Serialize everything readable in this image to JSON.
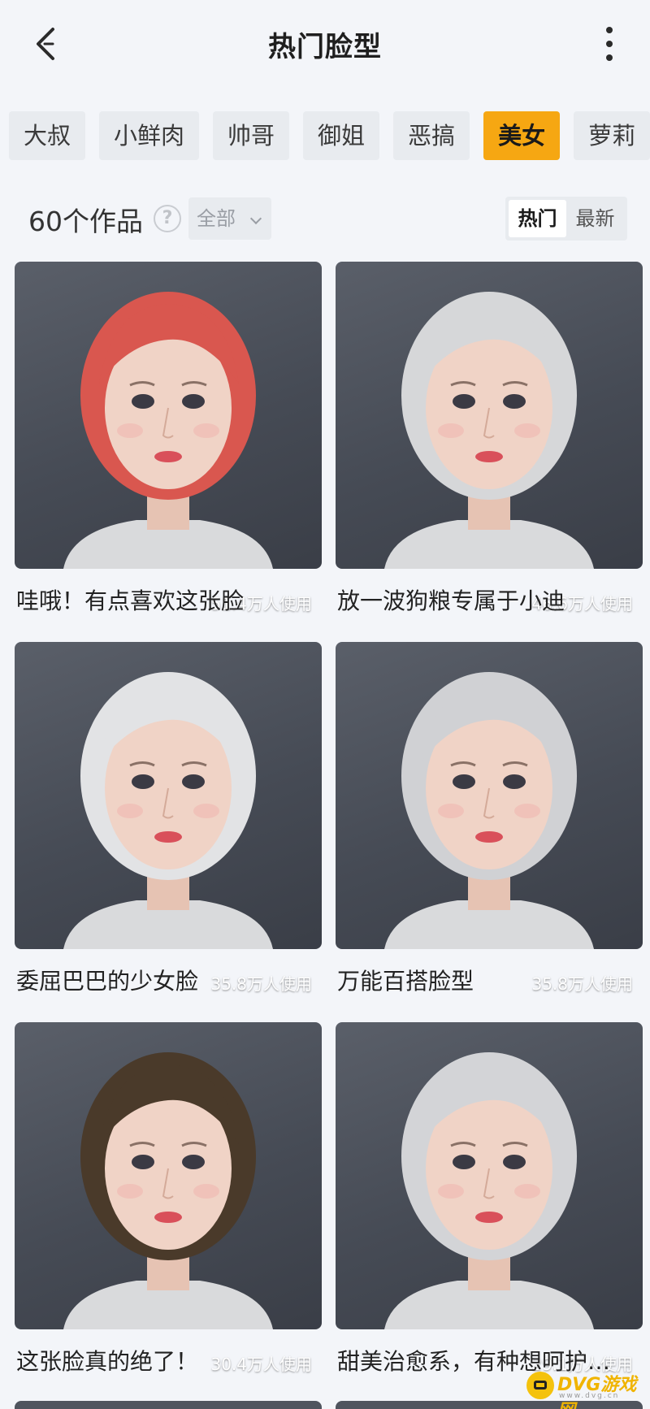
{
  "header": {
    "title": "热门脸型",
    "back_icon": "back-arrow-icon",
    "more_icon": "more-vertical-icon"
  },
  "tabs": [
    {
      "label": "大叔",
      "active": false
    },
    {
      "label": "小鲜肉",
      "active": false
    },
    {
      "label": "帅哥",
      "active": false
    },
    {
      "label": "御姐",
      "active": false
    },
    {
      "label": "恶搞",
      "active": false
    },
    {
      "label": "美女",
      "active": true
    },
    {
      "label": "萝莉",
      "active": false
    }
  ],
  "filter": {
    "count_text": "60个作品",
    "help_icon": "question-icon",
    "help_glyph": "?",
    "select_value": "全部",
    "sort_options": [
      "热门",
      "最新"
    ],
    "sort_active": "热门"
  },
  "cards": [
    {
      "usage": "51.4万人使用",
      "name": "哇哦！有点喜欢这张脸",
      "hair": "#d9574f"
    },
    {
      "usage": "46.6万人使用",
      "name": "放一波狗粮专属于小迪",
      "hair": "#d6d7d9"
    },
    {
      "usage": "35.8万人使用",
      "name": "委屈巴巴的少女脸",
      "hair": "#e2e3e5"
    },
    {
      "usage": "35.8万人使用",
      "name": "万能百搭脸型",
      "hair": "#d0d1d4"
    },
    {
      "usage": "30.4万人使用",
      "name": "这张脸真的绝了！",
      "hair": "#4a3a2a"
    },
    {
      "usage": "29.1万人使用",
      "name": "甜美治愈系，有种想呵护…",
      "hair": "#d3d4d7"
    }
  ],
  "watermark": {
    "text": "DVG游戏网",
    "sub": "www.dvg.cn"
  },
  "colors": {
    "accent": "#f6a712",
    "background": "#f3f5f9",
    "tab_bg": "#e8ebef"
  }
}
